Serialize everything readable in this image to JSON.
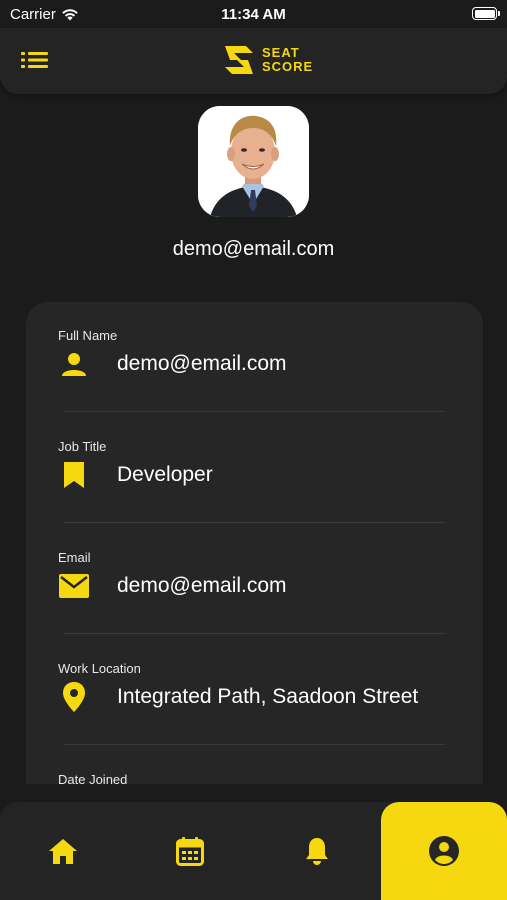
{
  "status_bar": {
    "carrier": "Carrier",
    "time": "11:34 AM"
  },
  "header": {
    "logo_line1": "SEAT",
    "logo_line2": "SCORE"
  },
  "profile": {
    "email": "demo@email.com"
  },
  "fields": [
    {
      "label": "Full Name",
      "value": "demo@email.com",
      "icon": "person-icon"
    },
    {
      "label": "Job Title",
      "value": "Developer",
      "icon": "bookmark-icon"
    },
    {
      "label": "Email",
      "value": "demo@email.com",
      "icon": "mail-icon"
    },
    {
      "label": "Work Location",
      "value": "Integrated Path, Saadoon Street",
      "icon": "location-pin-icon"
    },
    {
      "label": "Date Joined",
      "value": "",
      "icon": ""
    }
  ],
  "nav": [
    {
      "name": "home-icon",
      "active": false
    },
    {
      "name": "calendar-icon",
      "active": false
    },
    {
      "name": "bell-icon",
      "active": false
    },
    {
      "name": "profile-icon",
      "active": true
    }
  ],
  "colors": {
    "accent": "#f5d80f",
    "background": "#1b1b1b",
    "surface": "#262626"
  }
}
